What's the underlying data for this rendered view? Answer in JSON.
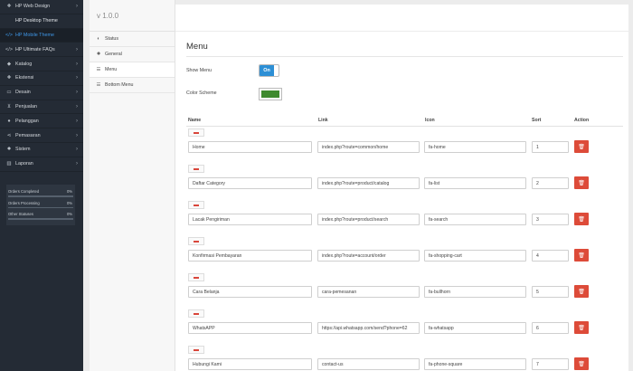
{
  "sidebar": {
    "items": [
      {
        "label": "HP Web Design",
        "icon": "puzzle-icon",
        "glyph": "✚",
        "chev": true
      },
      {
        "label": "HP Desktop Theme",
        "icon": "code-icon",
        "glyph": "",
        "chev": false,
        "sub": true
      },
      {
        "label": "HP Mobile Theme",
        "icon": "code-icon",
        "glyph": "</>",
        "chev": false,
        "active": true
      },
      {
        "label": "HP Ultimate FAQs",
        "icon": "code-icon",
        "glyph": "</>",
        "chev": true
      },
      {
        "label": "Katalog",
        "icon": "tag-icon",
        "glyph": "◆",
        "chev": true
      },
      {
        "label": "Ekstensi",
        "icon": "puzzle-icon",
        "glyph": "✚",
        "chev": true
      },
      {
        "label": "Desain",
        "icon": "monitor-icon",
        "glyph": "▭",
        "chev": true
      },
      {
        "label": "Penjualan",
        "icon": "cart-icon",
        "glyph": "⊻",
        "chev": true
      },
      {
        "label": "Pelanggan",
        "icon": "user-icon",
        "glyph": "●",
        "chev": true
      },
      {
        "label": "Pemasaran",
        "icon": "share-icon",
        "glyph": "⋖",
        "chev": true
      },
      {
        "label": "Sistem",
        "icon": "gear-icon",
        "glyph": "✹",
        "chev": true
      },
      {
        "label": "Laporan",
        "icon": "chart-icon",
        "glyph": "▥",
        "chev": true
      }
    ],
    "stats": [
      {
        "label": "Orders Completed",
        "pct": "0%"
      },
      {
        "label": "Orders Processing",
        "pct": "0%"
      },
      {
        "label": "Other Statuses",
        "pct": "0%"
      }
    ]
  },
  "subnav": {
    "version": "v 1.0.0",
    "items": [
      {
        "label": "Status",
        "icon": "toggle-icon",
        "glyph": "◐"
      },
      {
        "label": "General",
        "icon": "gear-icon",
        "glyph": "✹"
      },
      {
        "label": "Menu",
        "icon": "list-icon",
        "glyph": "☰",
        "active": true
      },
      {
        "label": "Bottom Menu",
        "icon": "list-icon",
        "glyph": "☰"
      }
    ]
  },
  "main": {
    "title": "Menu",
    "show_menu_label": "Show Menu",
    "toggle_label": "On",
    "color_scheme_label": "Color Scheme",
    "color_scheme_value": "#3e8a2e",
    "columns": {
      "name": "Name",
      "link": "Link",
      "icon": "Icon",
      "sort": "Sort",
      "action": "Action"
    },
    "rows": [
      {
        "name": "Home",
        "link": "index.php?route=common/home",
        "icon": "fa-home",
        "sort": "1"
      },
      {
        "name": "Daftar Category",
        "link": "index.php?route=product/catalog",
        "icon": "fa-list",
        "sort": "2"
      },
      {
        "name": "Lacak Pengiriman",
        "link": "index.php?route=product/search",
        "icon": "fa-search",
        "sort": "3"
      },
      {
        "name": "Konfirmasi Pembayaran",
        "link": "index.php?route=account/order",
        "icon": "fa-shopping-cart",
        "sort": "4"
      },
      {
        "name": "Cara Belanja",
        "link": "cara-pemesanan",
        "icon": "fa-bullhorn",
        "sort": "5"
      },
      {
        "name": "WhatsAPP",
        "link": "https://api.whatsapp.com/send?phone=62",
        "icon": "fa-whatsapp",
        "sort": "6"
      },
      {
        "name": "Hubungi Kami",
        "link": "contact-us",
        "icon": "fa-phone-square",
        "sort": "7"
      }
    ]
  }
}
